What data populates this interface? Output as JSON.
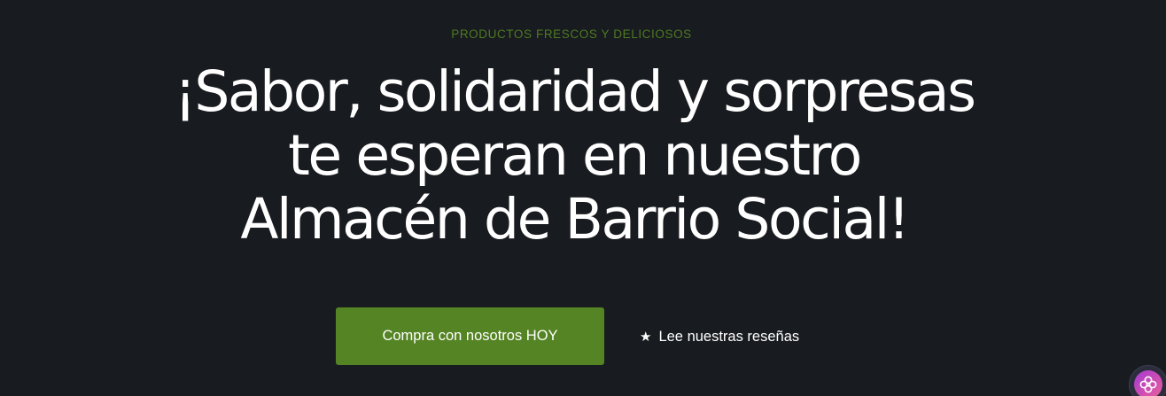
{
  "hero": {
    "eyebrow": "PRODUCTOS FRESCOS Y DELICIOSOS",
    "headline_lines": [
      "¡Sabor, solidaridad y sorpresas",
      "te esperan en nuestro",
      "Almacén de Barrio Social!"
    ],
    "primary_cta_label": "Compra con nosotros HOY",
    "secondary_cta_label": "Lee nuestras reseñas",
    "secondary_cta_icon": "star-icon"
  },
  "widget": {
    "icon": "flower-icon"
  },
  "colors": {
    "background": "#181b1f",
    "eyebrow": "#4e7a22",
    "headline": "#ffffff",
    "primary_button": "#548423",
    "widget_gradient_start": "#a13bd1",
    "widget_gradient_end": "#e3639a"
  }
}
